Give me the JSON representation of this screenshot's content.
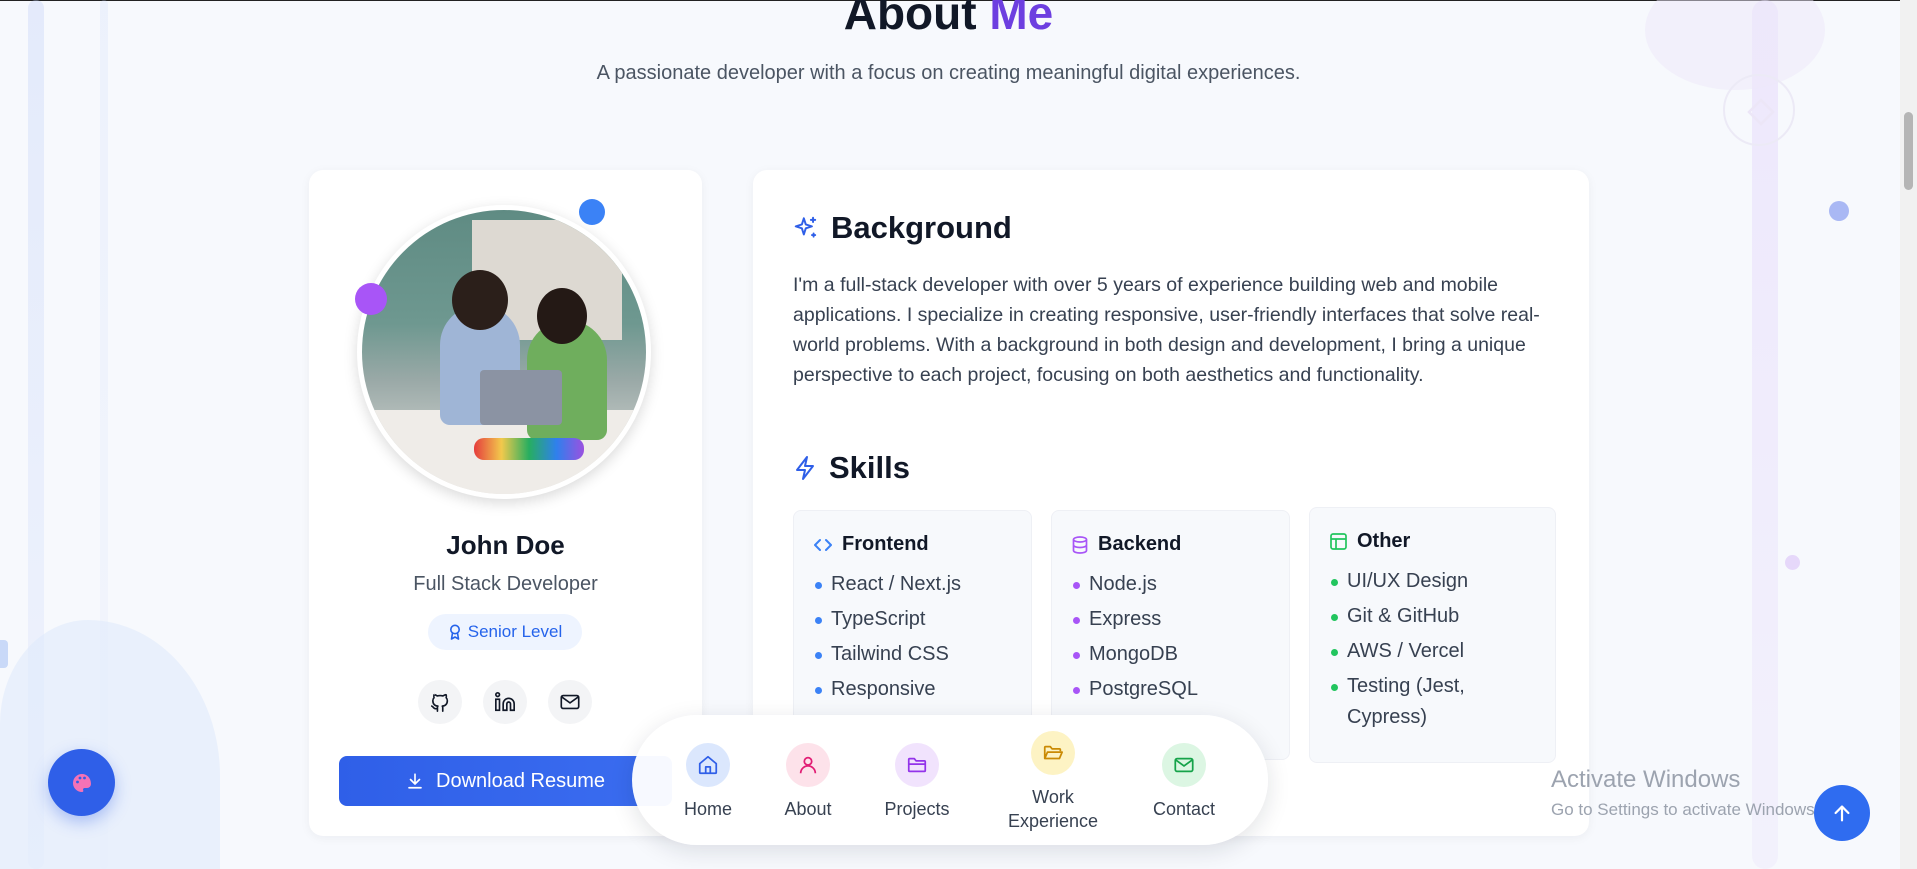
{
  "section": {
    "title_main": "About",
    "title_accent": "Me",
    "subtitle": "A passionate developer with a focus on creating meaningful digital experiences."
  },
  "profile": {
    "name": "John Doe",
    "role": "Full Stack Developer",
    "level": "Senior Level",
    "download_label": "Download Resume",
    "social": [
      "github-icon",
      "linkedin-icon",
      "mail-icon"
    ]
  },
  "background": {
    "heading": "Background",
    "text": "I'm a full-stack developer with over 5 years of experience building web and mobile applications. I specialize in creating responsive, user-friendly interfaces that solve real-world problems. With a background in both design and development, I bring a unique perspective to each project, focusing on both aesthetics and functionality."
  },
  "skills": {
    "heading": "Skills",
    "frontend": {
      "title": "Frontend",
      "items": [
        "React / Next.js",
        "TypeScript",
        "Tailwind CSS",
        "Responsive"
      ]
    },
    "backend": {
      "title": "Backend",
      "items": [
        "Node.js",
        "Express",
        "MongoDB",
        "PostgreSQL"
      ]
    },
    "other": {
      "title": "Other",
      "items": [
        "UI/UX Design",
        "Git & GitHub",
        "AWS / Vercel",
        "Testing (Jest, Cypress)"
      ]
    }
  },
  "nav": {
    "items": [
      {
        "label": "Home",
        "icon": "home-icon"
      },
      {
        "label": "About",
        "icon": "user-icon"
      },
      {
        "label": "Projects",
        "icon": "folder-icon"
      },
      {
        "label": "Work Experience",
        "icon": "folder-open-icon"
      },
      {
        "label": "Contact",
        "icon": "mail-icon"
      }
    ]
  },
  "watermark": {
    "line1": "Activate Windows",
    "line2": "Go to Settings to activate Windows."
  },
  "colors": {
    "accent": "#6d3fe0",
    "primary": "#2f5fe8",
    "frontend_dot": "#3b82f6",
    "backend_dot": "#a855f7",
    "other_dot": "#22c55e"
  }
}
